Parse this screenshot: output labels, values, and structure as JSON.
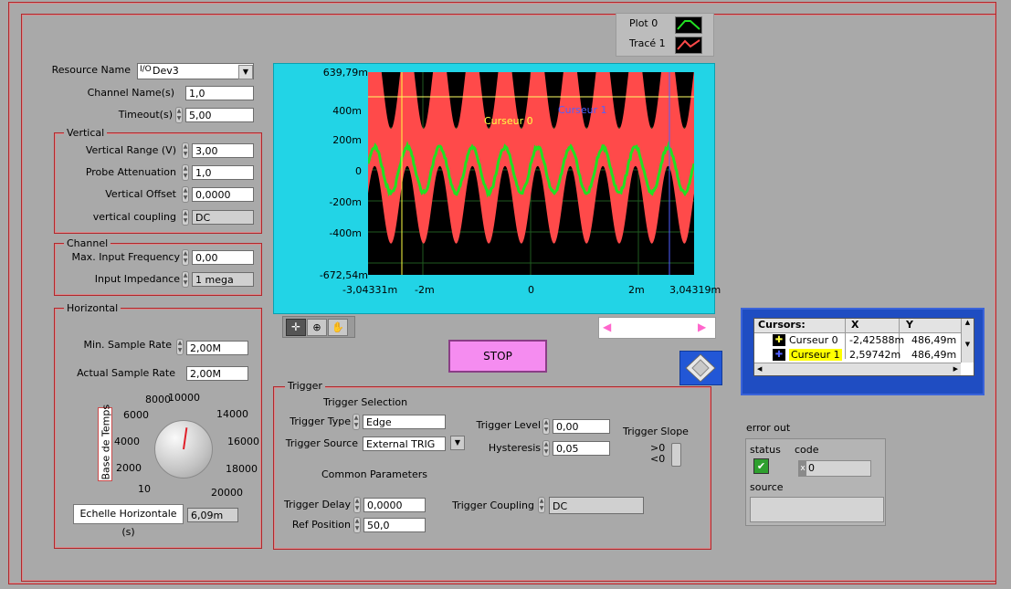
{
  "legend": {
    "plots": [
      {
        "name": "Plot 0",
        "color": "#22e022"
      },
      {
        "name": "Tracé 1",
        "color": "#ff4a4a"
      }
    ]
  },
  "resource": {
    "resource_name_label": "Resource Name",
    "resource_value": "Dev3",
    "channel_name_label": "Channel Name(s)",
    "channel_name_value": "1,0",
    "timeout_label": "Timeout(s)",
    "timeout_value": "5,00"
  },
  "vertical": {
    "title": "Vertical",
    "range_label": "Vertical Range (V)",
    "range_value": "3,00",
    "probe_label": "Probe Attenuation",
    "probe_value": "1,0",
    "offset_label": "Vertical Offset",
    "offset_value": "0,0000",
    "coupling_label": "vertical coupling",
    "coupling_value": "DC"
  },
  "channel": {
    "title": "Channel",
    "max_freq_label": "Max. Input Frequency",
    "max_freq_value": "0,00",
    "impedance_label": "Input Impedance",
    "impedance_value": "1 mega"
  },
  "horizontal": {
    "title": "Horizontal",
    "min_rate_label": "Min. Sample Rate",
    "min_rate_value": "2,00M",
    "actual_rate_label": "Actual Sample Rate",
    "actual_rate_value": "2,00M",
    "knob_label": "Base de Temps",
    "knob_level": 0.53,
    "knob_ticks": [
      "10",
      "2000",
      "4000",
      "6000",
      "8000",
      "10000",
      "14000",
      "16000",
      "18000",
      "20000"
    ],
    "scale_label": "Echelle Horizontale (s)",
    "scale_value": "6,09m"
  },
  "graph": {
    "y_ticks": [
      "639,79m",
      "400m",
      "200m",
      "0",
      "-200m",
      "-400m",
      "-672,54m"
    ],
    "x_ticks": [
      "-3,04331m",
      "-2m",
      "0",
      "2m",
      "3,04319m"
    ],
    "cursor0_label": "Curseur 0",
    "cursor1_label": "Curseur 1"
  },
  "stop_label": "STOP",
  "trigger": {
    "title": "Trigger",
    "selection_label": "Trigger Selection",
    "type_label": "Trigger Type",
    "type_value": "Edge",
    "source_label": "Trigger Source",
    "source_value": "External TRIG",
    "level_label": "Trigger Level",
    "level_value": "0,00",
    "hysteresis_label": "Hysteresis",
    "hysteresis_value": "0,05",
    "slope_label": "Trigger Slope",
    "slope_up": ">0",
    "slope_down": "<0",
    "common_label": "Common Parameters",
    "delay_label": "Trigger Delay",
    "delay_value": "0,0000",
    "refpos_label": "Ref Position",
    "refpos_value": "50,0",
    "coupling_label": "Trigger Coupling",
    "coupling_value": "DC"
  },
  "cursors": {
    "header_name": "Cursors:",
    "header_x": "X",
    "header_y": "Y",
    "rows": [
      {
        "name": "Curseur 0",
        "x": "-2,42588m",
        "y": "486,49m"
      },
      {
        "name": "Curseur 1",
        "x": "2,59742m",
        "y": "486,49m"
      }
    ]
  },
  "error_out": {
    "title": "error out",
    "status_label": "status",
    "code_label": "code",
    "code_value": "0",
    "code_prefix": "x",
    "source_label": "source",
    "source_value": ""
  }
}
